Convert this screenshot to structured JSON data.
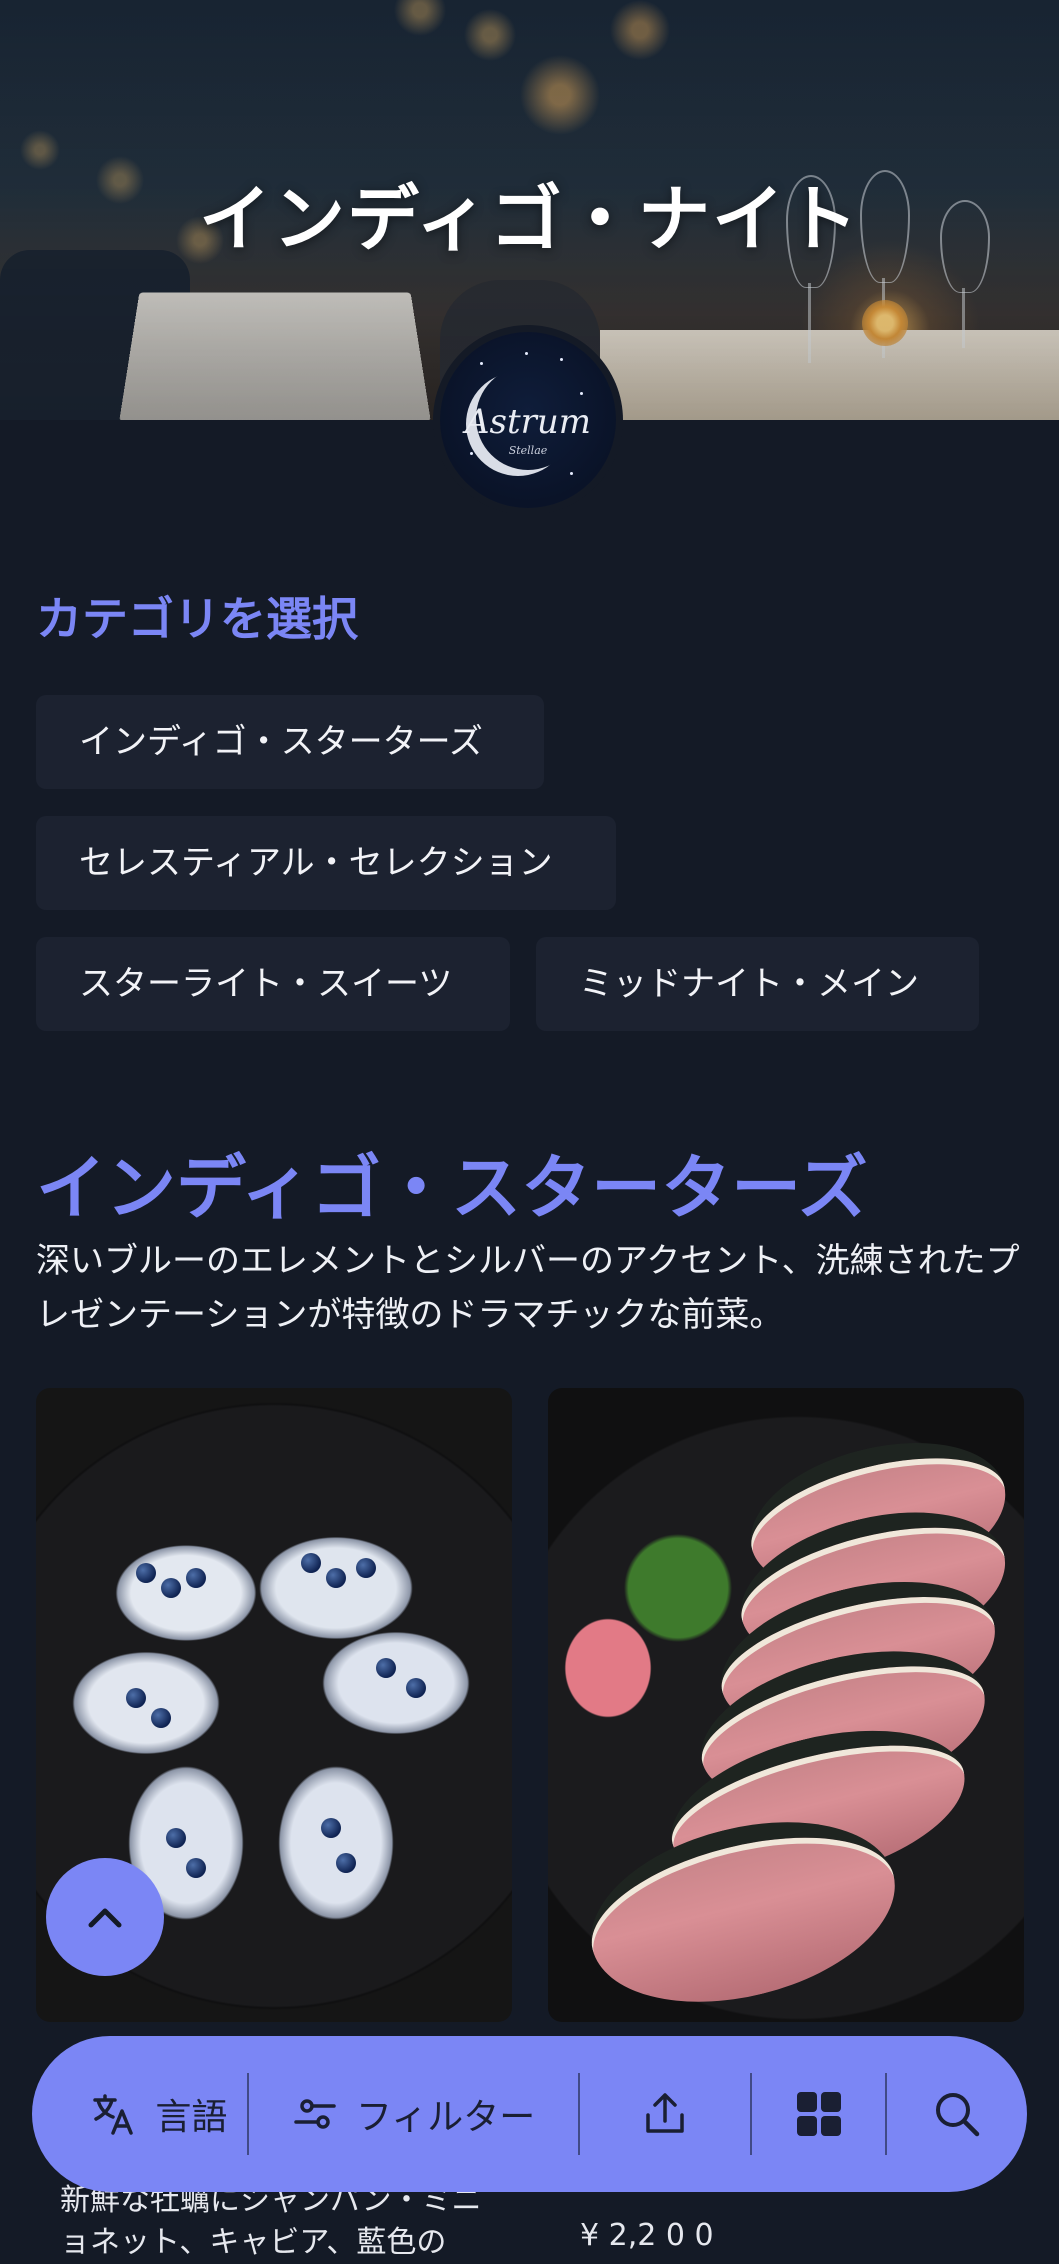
{
  "hero": {
    "title": "インディゴ・ナイト"
  },
  "logo": {
    "name": "Astrum",
    "sub": "Stellae"
  },
  "categories": {
    "heading": "カテゴリを選択",
    "items": [
      {
        "label": "インディゴ・スターターズ"
      },
      {
        "label": "セレスティアル・セレクション"
      },
      {
        "label": "スターライト・スイーツ"
      },
      {
        "label": "ミッドナイト・メイン"
      }
    ]
  },
  "section": {
    "title": "インディゴ・スターターズ",
    "description": "深いブルーのエレメントとシルバーのアクセント、洗練されたプレゼンテーションが特徴のドラマチックな前菜。"
  },
  "toolbar": {
    "language_label": "言語",
    "filter_label": "フィルター"
  },
  "below": {
    "text": "新鮮な牡蠣にシャンパン・ミニョネット、キャビア、藍色の",
    "price": "¥ 2,2 0 0"
  },
  "colors": {
    "accent": "#7b86f5",
    "background": "#141a26",
    "chip": "#1c2230"
  },
  "icons": [
    "translate-icon",
    "filter-sliders-icon",
    "share-upload-icon",
    "grid-icon",
    "search-icon",
    "chevron-up-icon"
  ]
}
